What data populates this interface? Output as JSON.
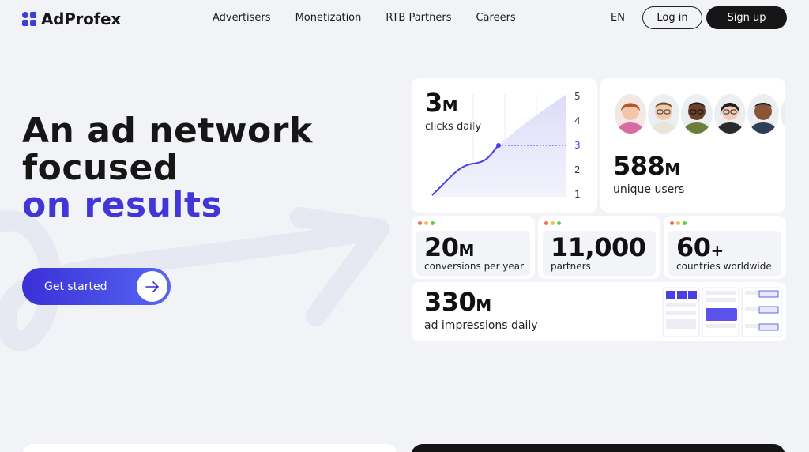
{
  "brand": {
    "name": "AdProfex",
    "accent": "#4336d8"
  },
  "nav": [
    {
      "label": "Advertisers"
    },
    {
      "label": "Monetization"
    },
    {
      "label": "RTB Partners"
    },
    {
      "label": "Careers"
    }
  ],
  "header": {
    "lang": "EN",
    "login": "Log in",
    "signup": "Sign up"
  },
  "hero": {
    "line1": "An ad network",
    "line2": "focused",
    "line3": "on results",
    "cta": "Get started"
  },
  "stats": {
    "clicks": {
      "num": "3",
      "unit": "M",
      "label": "clicks daily",
      "axis": [
        "5",
        "4",
        "3",
        "2",
        "1"
      ],
      "highlight": "3"
    },
    "users": {
      "num": "588",
      "unit": "M",
      "label": "unique users"
    },
    "conversions": {
      "num": "20",
      "unit": "M",
      "label": "conversions per year"
    },
    "partners": {
      "num": "11,000",
      "unit": "",
      "label": "partners"
    },
    "countries": {
      "num": "60",
      "unit": "+",
      "label": "countries worldwide"
    },
    "impressions": {
      "num": "330",
      "unit": "M",
      "label": "ad impressions daily"
    }
  },
  "window_dots": [
    "#f26b5b",
    "#f5c043",
    "#5fc95a"
  ]
}
